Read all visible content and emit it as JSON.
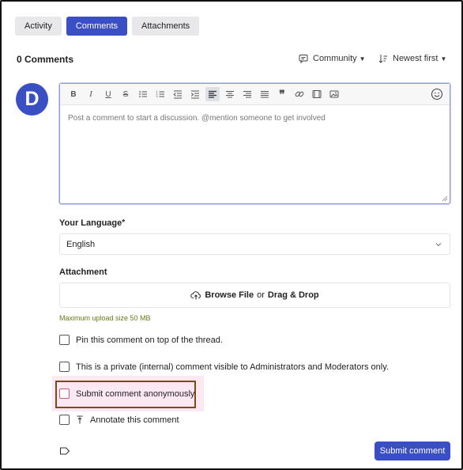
{
  "tabs": [
    {
      "label": "Activity",
      "active": false
    },
    {
      "label": "Comments",
      "active": true
    },
    {
      "label": "Attachments",
      "active": false
    }
  ],
  "comments": {
    "count_label": "0 Comments",
    "filter_label": "Community",
    "sort_label": "Newest first"
  },
  "user": {
    "avatar_initial": "D"
  },
  "editor": {
    "placeholder": "Post a comment to start a discussion. @mention someone to get involved",
    "toolbar": [
      "bold-icon",
      "italic-icon",
      "underline-icon",
      "strikethrough-icon",
      "bullet-list-icon",
      "numbered-list-icon",
      "outdent-icon",
      "indent-icon",
      "align-left-icon",
      "align-center-icon",
      "align-right-icon",
      "align-justify-icon",
      "quote-icon",
      "link-icon",
      "video-icon",
      "image-icon"
    ],
    "active_tool": "align-left-icon"
  },
  "language": {
    "label": "Your Language",
    "required_mark": "*",
    "value": "English"
  },
  "attachment": {
    "label": "Attachment",
    "browse": "Browse File",
    "or": "or",
    "drop": "Drag & Drop",
    "hint": "Maximum upload size 50 MB"
  },
  "options": {
    "pin": "Pin this comment on top of the thread.",
    "private": "This is a private (internal) comment visible to Administrators and Moderators only.",
    "anonymous": "Submit comment anonymously",
    "annotate": "Annotate this comment"
  },
  "submit_label": "Submit comment",
  "colors": {
    "accent": "#3b4fc4",
    "highlight_bg": "#fce8f3",
    "highlight_border": "#7a4b14",
    "hint": "#6a7a1a"
  }
}
